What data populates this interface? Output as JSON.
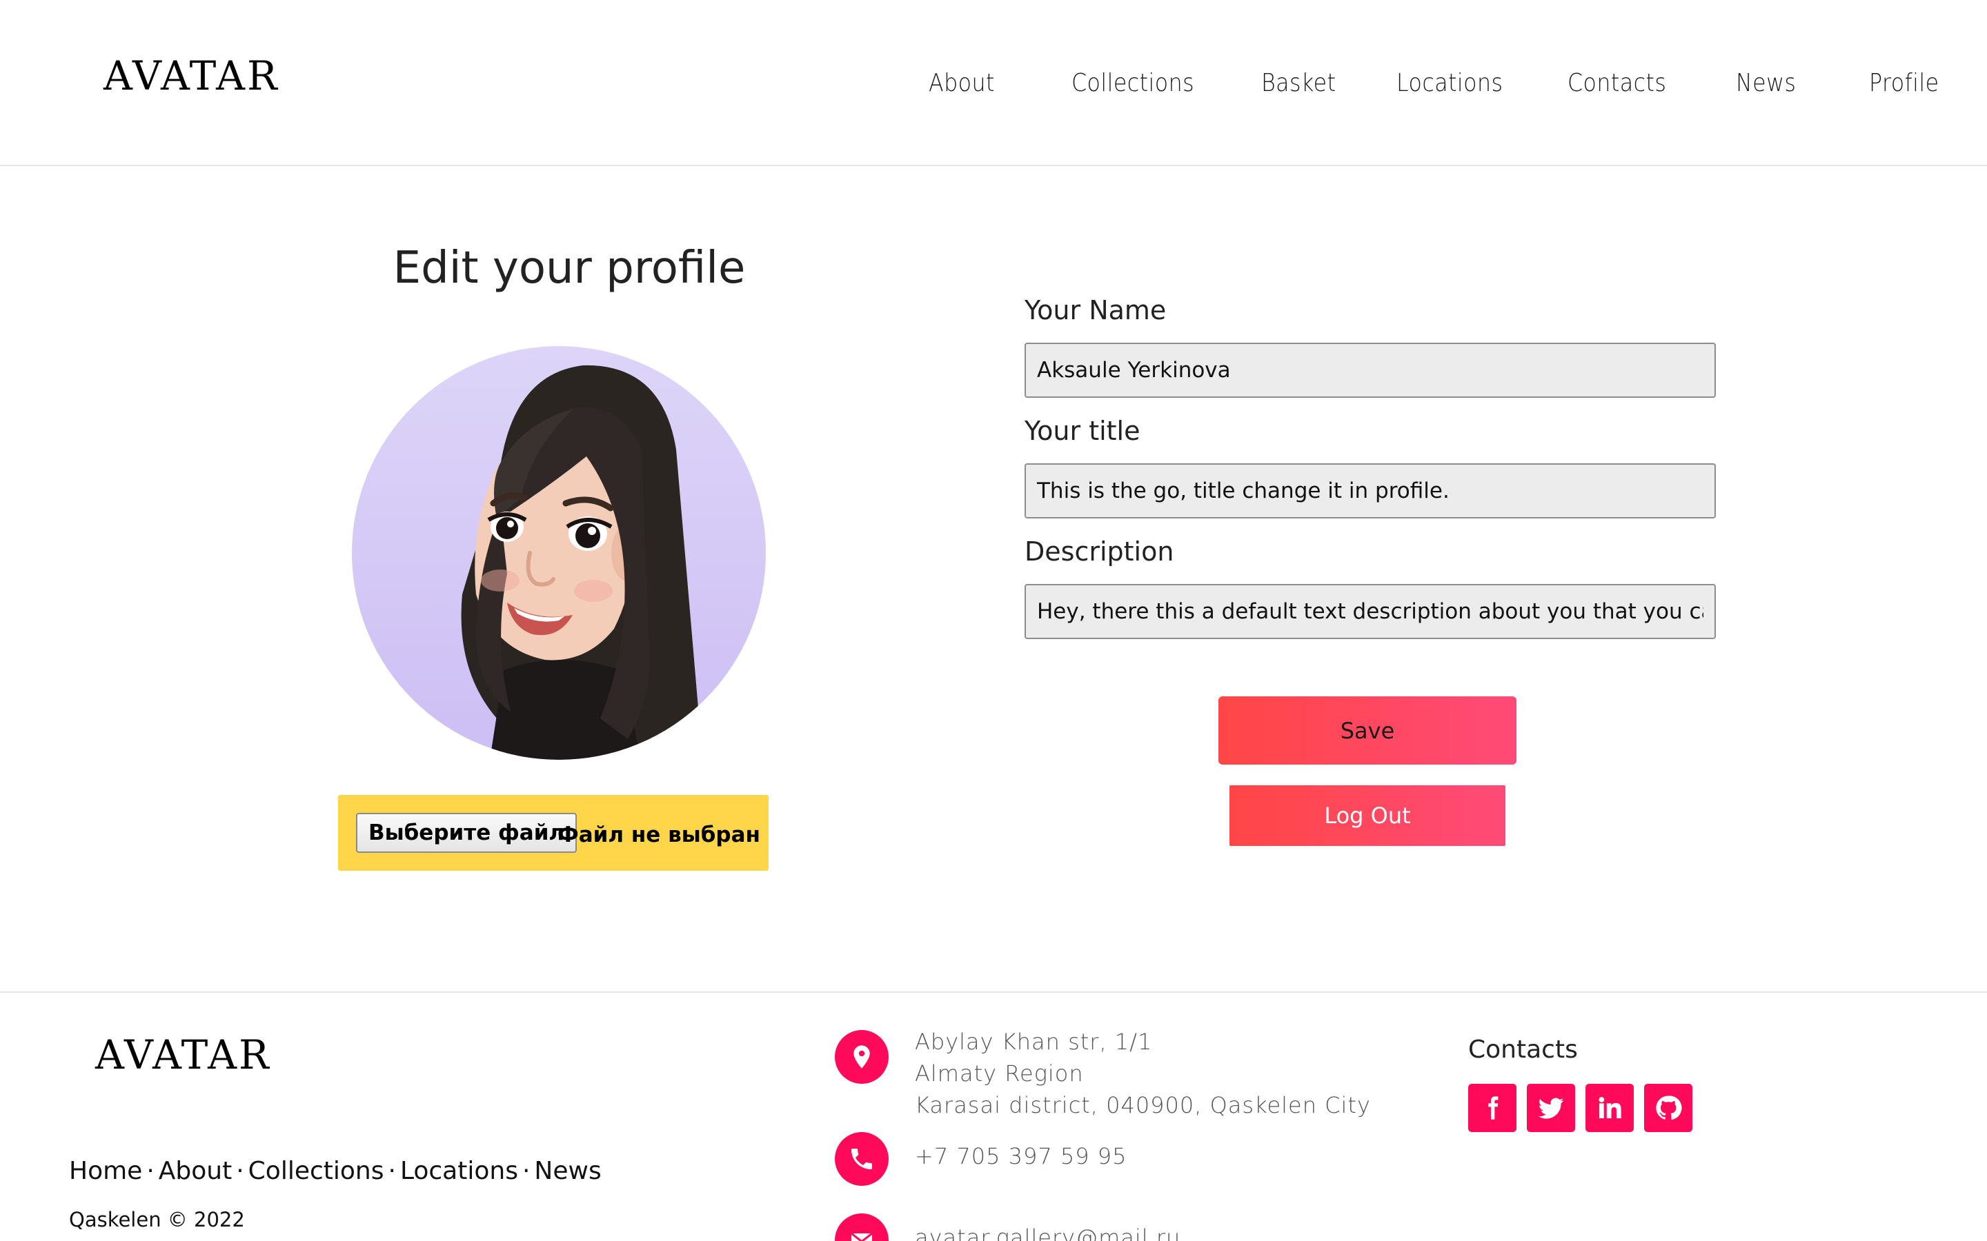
{
  "header": {
    "logo": "AVATAR",
    "nav": [
      "About",
      "Collections",
      "Basket",
      "Locations",
      "Contacts",
      "News",
      "Profile"
    ]
  },
  "profile": {
    "title": "Edit your profile",
    "file_button": "Выберите файл",
    "file_status": "Файл не выбран",
    "name_label": "Your Name",
    "name_value": "Aksaule Yerkinova",
    "title_label": "Your title",
    "title_value": "This is the go, title change it in profile.",
    "description_label": "Description",
    "description_value": "Hey, there this a default text description about you that you can c",
    "save_label": "Save",
    "logout_label": "Log Out"
  },
  "footer": {
    "logo": "AVATAR",
    "nav": [
      "Home",
      "About",
      "Collections",
      "Locations",
      "News"
    ],
    "nav_separator": "·",
    "copyright": "Qaskelen © 2022",
    "address": [
      "Abylay Khan str, 1/1",
      "Almaty Region",
      "Karasai district, 040900, Qaskelen City"
    ],
    "phone": "+7 705 397 59 95",
    "email": "avatar.gallery@mail.ru",
    "contacts_title": "Contacts",
    "social": [
      "facebook-icon",
      "twitter-icon",
      "linkedin-icon",
      "github-icon"
    ]
  },
  "colors": {
    "accent": "#ff0a5a",
    "button_gradient_start": "#ff4646",
    "button_gradient_end": "#ff4a78",
    "file_box": "#ffd54a",
    "avatar_bg": "#d6cbf7"
  }
}
